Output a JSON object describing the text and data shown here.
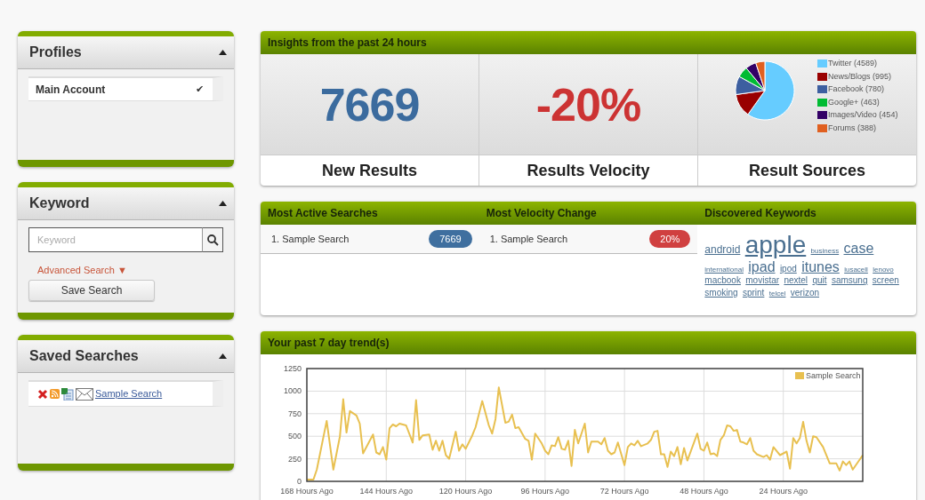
{
  "profiles": {
    "title": "Profiles",
    "items": [
      {
        "label": "Main Account",
        "selected": true,
        "check": "✔"
      }
    ]
  },
  "keyword": {
    "title": "Keyword",
    "search": {
      "placeholder": "Keyword"
    },
    "advanced_link": "Advanced Search ▼",
    "save_button": "Save Search"
  },
  "saved_searches": {
    "title": "Saved Searches",
    "items": [
      {
        "label": "Sample Search"
      }
    ]
  },
  "insights": {
    "title": "Insights from the past 24 hours",
    "new_results": {
      "value": "7669",
      "label": "New Results"
    },
    "velocity": {
      "value": "-20%",
      "label": "Results Velocity"
    },
    "sources": {
      "label": "Result Sources",
      "chart_data": {
        "type": "pie",
        "legend": "right",
        "categories": [
          "Twitter (4589)",
          "News/Blogs (995)",
          "Facebook (780)",
          "Google+ (463)",
          "Images/Video (454)",
          "Forums (388)"
        ],
        "values": [
          4589,
          995,
          780,
          463,
          454,
          388
        ],
        "colors": [
          "#66ccff",
          "#990000",
          "#3d5fa0",
          "#00bb33",
          "#330066",
          "#e06020"
        ]
      }
    }
  },
  "lists": {
    "most_active": {
      "title": "Most Active Searches",
      "items": [
        {
          "label": "1. Sample Search",
          "count": "7669"
        }
      ]
    },
    "velocity_change": {
      "title": "Most Velocity Change",
      "items": [
        {
          "label": "1. Sample Search",
          "count": "20%"
        }
      ]
    },
    "keywords": {
      "title": "Discovered Keywords",
      "items": [
        {
          "text": "android",
          "kind": "md"
        },
        {
          "text": "apple",
          "kind": "xl"
        },
        {
          "text": "business",
          "kind": "xs"
        },
        {
          "text": "case",
          "kind": "lg"
        },
        {
          "text": "international",
          "kind": "xs"
        },
        {
          "text": "ipad",
          "kind": "lg"
        },
        {
          "text": "ipod",
          "kind": "sm"
        },
        {
          "text": "itunes",
          "kind": "lg"
        },
        {
          "text": "iusacell",
          "kind": "xs"
        },
        {
          "text": "lenovo",
          "kind": "xs"
        },
        {
          "text": "macbook",
          "kind": "sm"
        },
        {
          "text": "movistar",
          "kind": "sm"
        },
        {
          "text": "nextel",
          "kind": "sm"
        },
        {
          "text": "quit",
          "kind": "sm"
        },
        {
          "text": "samsung",
          "kind": "sm"
        },
        {
          "text": "screen",
          "kind": "sm"
        },
        {
          "text": "smoking",
          "kind": "sm"
        },
        {
          "text": "sprint",
          "kind": "sm"
        },
        {
          "text": "telcel",
          "kind": "xs"
        },
        {
          "text": "verizon",
          "kind": "sm"
        }
      ]
    }
  },
  "trend": {
    "title": "Your past 7 day trend(s)",
    "chart_data": {
      "type": "line",
      "grid": true,
      "xlim": [
        168,
        0
      ],
      "ylim": [
        0,
        1250
      ],
      "yticks": [
        0,
        250,
        500,
        750,
        1000,
        1250
      ],
      "xticks": [
        {
          "value": 168,
          "label": "168 Hours Ago"
        },
        {
          "value": 144,
          "label": "144 Hours Ago"
        },
        {
          "value": 120,
          "label": "120 Hours Ago"
        },
        {
          "value": 96,
          "label": "96 Hours Ago"
        },
        {
          "value": 72,
          "label": "72 Hours Ago"
        },
        {
          "value": 48,
          "label": "48 Hours Ago"
        },
        {
          "value": 24,
          "label": "24 Hours Ago"
        }
      ],
      "x": [
        168,
        166,
        165,
        162,
        160,
        158,
        157,
        156,
        155,
        153,
        152,
        151,
        148,
        147,
        146,
        145,
        144,
        143,
        142,
        141,
        140,
        138,
        136,
        135,
        134,
        133,
        131,
        130,
        129,
        128,
        127,
        126,
        125,
        123,
        122,
        121,
        120,
        118,
        117,
        115,
        113,
        112,
        111,
        110,
        108,
        107,
        106,
        105,
        104,
        102,
        101,
        100,
        99,
        97,
        96,
        95,
        94,
        93,
        92,
        91,
        90,
        89,
        88,
        87,
        86,
        84,
        83,
        82,
        80,
        79,
        78,
        77,
        76,
        75,
        74,
        72,
        71,
        70,
        69,
        68,
        67,
        65,
        64,
        63,
        62,
        61,
        60,
        59,
        58,
        57,
        56,
        55,
        54,
        53,
        50,
        49,
        48,
        47,
        46,
        45,
        44,
        43,
        42,
        41,
        40,
        39,
        38,
        37,
        36,
        35,
        34,
        33,
        32,
        30,
        29,
        28,
        27,
        25,
        23,
        22,
        21,
        20,
        19,
        18,
        17,
        16,
        15,
        14,
        12,
        10,
        8,
        7,
        6,
        5,
        4,
        3,
        0
      ],
      "series": [
        {
          "name": "Sample Search",
          "color": "#e8c050",
          "values": [
            20,
            20,
            130,
            670,
            130,
            500,
            910,
            540,
            780,
            730,
            640,
            310,
            520,
            320,
            300,
            380,
            240,
            590,
            630,
            610,
            640,
            620,
            430,
            900,
            460,
            510,
            520,
            350,
            450,
            340,
            450,
            290,
            250,
            550,
            340,
            410,
            360,
            510,
            600,
            890,
            620,
            530,
            690,
            1040,
            650,
            660,
            740,
            590,
            600,
            470,
            450,
            240,
            530,
            420,
            340,
            300,
            400,
            390,
            490,
            360,
            350,
            450,
            170,
            570,
            420,
            640,
            320,
            440,
            440,
            410,
            480,
            340,
            300,
            320,
            430,
            180,
            380,
            420,
            400,
            450,
            390,
            420,
            460,
            550,
            560,
            300,
            300,
            160,
            330,
            280,
            380,
            190,
            370,
            230,
            530,
            360,
            340,
            430,
            300,
            310,
            280,
            460,
            510,
            620,
            610,
            560,
            570,
            440,
            430,
            410,
            480,
            340,
            300,
            270,
            290,
            240,
            380,
            290,
            330,
            140,
            480,
            420,
            480,
            660,
            450,
            320,
            500,
            490,
            380,
            200,
            200,
            120,
            220,
            180,
            220,
            130,
            290
          ]
        }
      ]
    }
  }
}
